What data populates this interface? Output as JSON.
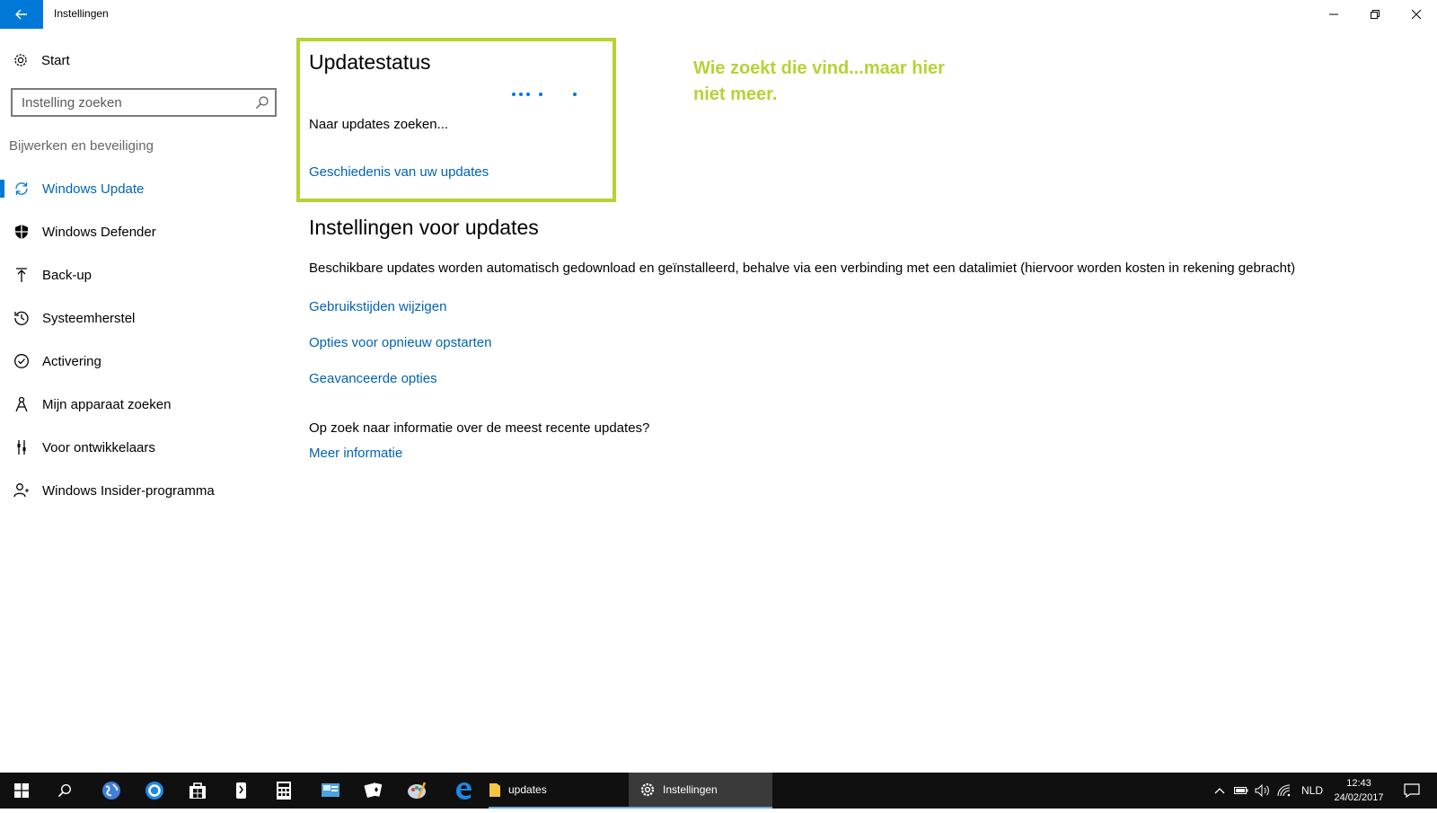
{
  "window": {
    "title": "Instellingen"
  },
  "sidebar": {
    "start_label": "Start",
    "search_placeholder": "Instelling zoeken",
    "section_label": "Bijwerken en beveiliging",
    "items": [
      {
        "label": "Windows Update",
        "icon": "sync-icon",
        "active": true
      },
      {
        "label": "Windows Defender",
        "icon": "shield-icon",
        "active": false
      },
      {
        "label": "Back-up",
        "icon": "upload-arrow-icon",
        "active": false
      },
      {
        "label": "Systeemherstel",
        "icon": "history-icon",
        "active": false
      },
      {
        "label": "Activering",
        "icon": "check-circle-icon",
        "active": false
      },
      {
        "label": "Mijn apparaat zoeken",
        "icon": "find-device-icon",
        "active": false
      },
      {
        "label": "Voor ontwikkelaars",
        "icon": "developer-tools-icon",
        "active": false
      },
      {
        "label": "Windows Insider-programma",
        "icon": "insider-person-icon",
        "active": false
      }
    ]
  },
  "main": {
    "status_title": "Updatestatus",
    "status_text": "Naar updates zoeken...",
    "history_link": "Geschiedenis van uw updates",
    "annotation": "Wie zoekt die vind...maar hier niet meer.",
    "settings_title": "Instellingen voor updates",
    "settings_desc": "Beschikbare updates worden automatisch gedownload en geïnstalleerd, behalve via een verbinding met een datalimiet (hiervoor worden kosten in rekening gebracht)",
    "links": {
      "usage_hours": "Gebruikstijden wijzigen",
      "restart_options": "Opties voor opnieuw opstarten",
      "advanced_options": "Geavanceerde opties"
    },
    "info_question": "Op zoek naar informatie over de meest recente updates?",
    "more_info": "Meer informatie"
  },
  "taskbar": {
    "apps": [
      {
        "label": "updates",
        "icon": "folder-icon"
      },
      {
        "label": "Instellingen",
        "icon": "gear-icon"
      }
    ],
    "language": "NLD",
    "time": "12:43",
    "date": "24/02/2017"
  },
  "colors": {
    "accent": "#0078d7",
    "link": "#0063b1",
    "highlight": "#b5d334",
    "taskbar": "#101010"
  }
}
